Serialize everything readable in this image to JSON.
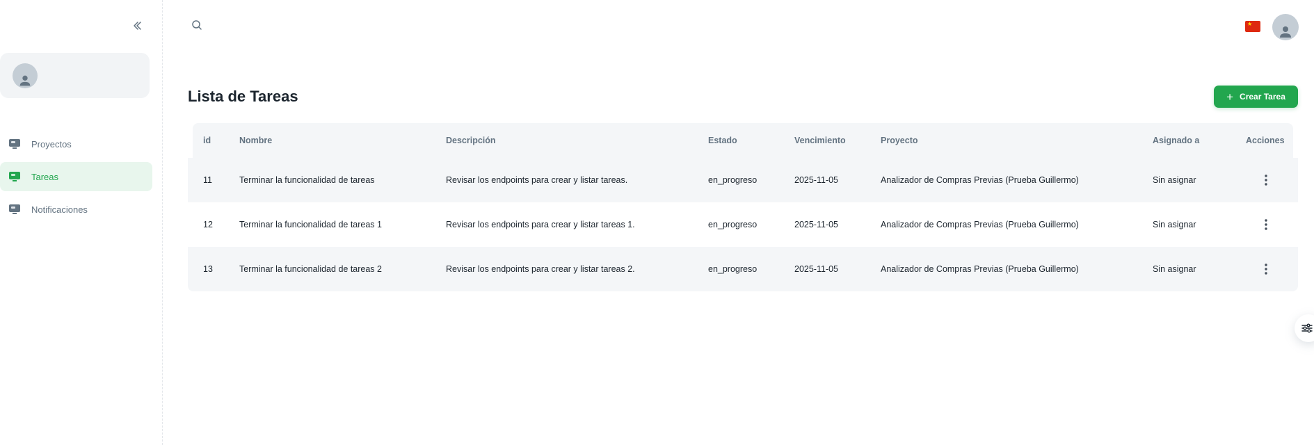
{
  "sidebar": {
    "items": [
      {
        "label": "Proyectos",
        "icon": "monitor-icon"
      },
      {
        "label": "Tareas",
        "icon": "monitor-icon"
      },
      {
        "label": "Notificaciones",
        "icon": "monitor-icon"
      }
    ],
    "active_index": 1
  },
  "header": {
    "language_flag": "china-flag-icon"
  },
  "page": {
    "title": "Lista de Tareas",
    "create_label": "Crear Tarea"
  },
  "table": {
    "columns": [
      "id",
      "Nombre",
      "Descripción",
      "Estado",
      "Vencimiento",
      "Proyecto",
      "Asignado a",
      "Acciones"
    ],
    "rows": [
      {
        "id": "11",
        "nombre": "Terminar la funcionalidad de tareas",
        "descripcion": "Revisar los endpoints para crear y listar tareas.",
        "estado": "en_progreso",
        "vencimiento": "2025-11-05",
        "proyecto": "Analizador de Compras Previas (Prueba Guillermo)",
        "asignado": "Sin asignar"
      },
      {
        "id": "12",
        "nombre": "Terminar la funcionalidad de tareas 1",
        "descripcion": "Revisar los endpoints para crear y listar tareas 1.",
        "estado": "en_progreso",
        "vencimiento": "2025-11-05",
        "proyecto": "Analizador de Compras Previas (Prueba Guillermo)",
        "asignado": "Sin asignar"
      },
      {
        "id": "13",
        "nombre": "Terminar la funcionalidad de tareas 2",
        "descripcion": "Revisar los endpoints para crear y listar tareas 2.",
        "estado": "en_progreso",
        "vencimiento": "2025-11-05",
        "proyecto": "Analizador de Compras Previas (Prueba Guillermo)",
        "asignado": "Sin asignar"
      }
    ]
  },
  "colors": {
    "accent": "#22a64e",
    "active_bg": "#e8f6ed",
    "row_alt": "#f4f6f8",
    "text_muted": "#637381"
  }
}
